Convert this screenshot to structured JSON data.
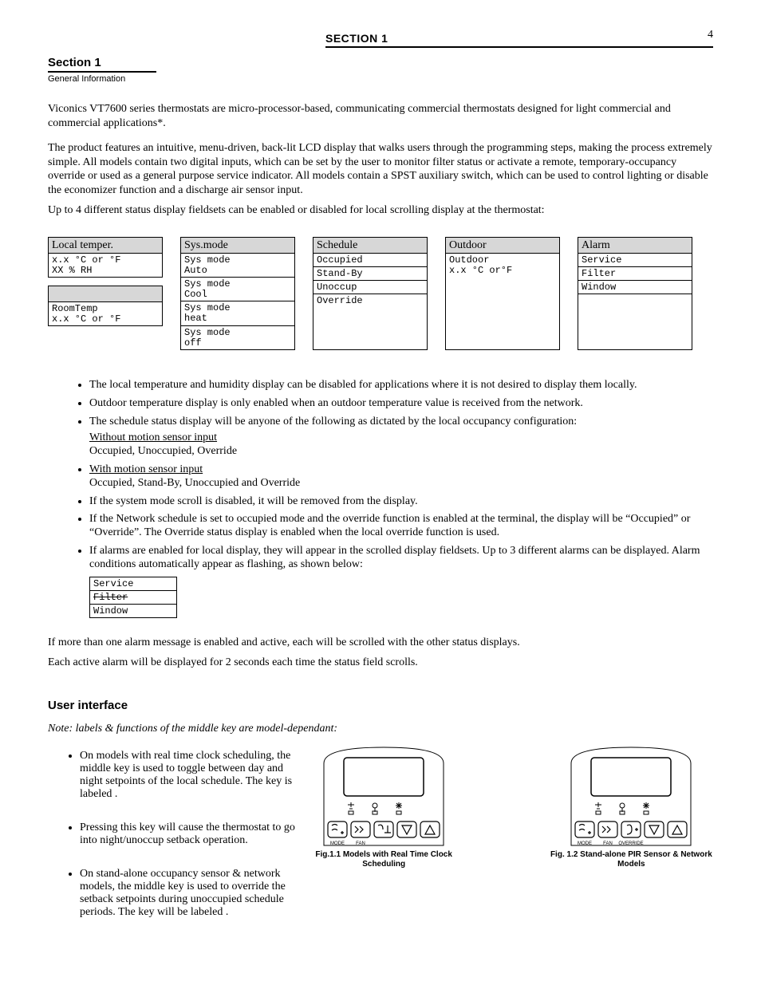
{
  "page_number": "4",
  "header_section": "SECTION 1",
  "section": {
    "title": "Section 1",
    "subtitle": "General Information"
  },
  "intro_para": "Viconics VT7600 series thermostats are micro-processor-based, communicating commercial thermostats designed for light commercial and commercial applications*.",
  "intro_para2": "The product features an intuitive, menu-driven, back-lit LCD display that walks users through the programming steps, making the process extremely simple. All models contain two digital inputs, which can be set by the user to monitor filter status or activate a remote, temporary-occupancy override or used as a general purpose service indicator. All models contain a SPST auxiliary switch, which can be used to control lighting or disable the economizer function and a discharge air sensor input.",
  "fieldset_intro": "Up to 4 different status display fieldsets can be enabled or disabled for local scrolling display at the thermostat:",
  "columns": [
    {
      "header": "Local temper.",
      "groups": [
        {
          "cells": [
            "x.x °C or °F\nXX % RH"
          ]
        },
        {
          "cells": [
            "RoomTemp\nx.x °C or °F"
          ]
        }
      ]
    },
    {
      "header": "Sys.mode",
      "groups": [
        {
          "cells": [
            "Sys mode\nAuto",
            "Sys mode\nCool",
            "Sys mode\nheat",
            "Sys mode\noff"
          ]
        }
      ]
    },
    {
      "header": "Schedule",
      "groups": [
        {
          "cells": [
            "Occupied",
            "Stand-By",
            "Unoccup",
            "Override"
          ]
        }
      ]
    },
    {
      "header": "Outdoor",
      "groups": [
        {
          "cells": [
            "Outdoor\nx.x °C or°F"
          ]
        }
      ]
    },
    {
      "header": "Alarm",
      "groups": [
        {
          "cells": [
            "Service",
            "Filter",
            "Window",
            " "
          ]
        }
      ]
    }
  ],
  "bullets": [
    "The local temperature and humidity display can be disabled for applications where it is not desired to display them locally.",
    "Outdoor temperature display is only enabled when an outdoor temperature value is received from the network.",
    "The schedule status display will be anyone of the following as dictated by the local occupancy configuration:",
    "Without motion sensor input\nOccupied, Unoccupied, Override",
    "With motion sensor input\nOccupied, Stand-By, Unoccupied and Override",
    "If the system mode scroll is disabled, it will be removed from the display.",
    "If the Network schedule is set to occupied mode and the override function is enabled at the terminal, the display will be “Occupied” or “Override”. The Override status display is enabled when the local override function is used.",
    "If alarms are enabled for local display, they will appear in the scrolled display fieldsets. Up to 3 different alarms can be displayed. Alarm conditions automatically appear as flashing, as shown below:"
  ],
  "mini_table": {
    "cells": [
      "Service",
      "Filter",
      "Window"
    ]
  },
  "alarm_text": "If more than one alarm message is enabled and active, each will be scrolled with the other status displays.",
  "alarm_text2": "Each active alarm will be displayed for 2 seconds each time the status field scrolls.",
  "iface_heading": "User interface",
  "iface_note": "Note: labels & functions of the middle key are model-dependant:",
  "iface_items": [
    "On models with real time clock scheduling, the middle key is used to toggle between day and night setpoints of the local schedule. The key is labeled .",
    "Pressing this key will cause the thermostat to go into night/unoccup setback operation.",
    "On stand-alone occupancy sensor & network models, the middle key is used to override the setback setpoints during unoccupied schedule periods. The key will be labeled ."
  ],
  "keypads": [
    {
      "third_label": "",
      "caption": "Fig.1.1 Models with Real Time Clock Scheduling"
    },
    {
      "third_label": "OVERRIDE",
      "caption": "Fig. 1.2 Stand-alone PIR Sensor & Network Models"
    }
  ]
}
